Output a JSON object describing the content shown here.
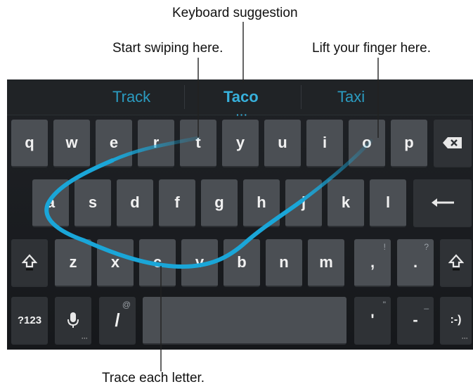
{
  "callouts": {
    "keyboard_suggestion": "Keyboard suggestion",
    "start_swiping": "Start swiping here.",
    "lift_finger": "Lift your finger here.",
    "trace_letter": "Trace each letter."
  },
  "suggestions": [
    "Track",
    "Taco",
    "Taxi"
  ],
  "suggestion_dots": "···",
  "rows": {
    "row1": [
      "q",
      "w",
      "e",
      "r",
      "t",
      "y",
      "u",
      "i",
      "o",
      "p"
    ],
    "row2": [
      "a",
      "s",
      "d",
      "f",
      "g",
      "h",
      "j",
      "k",
      "l"
    ],
    "row3": [
      "z",
      "x",
      "c",
      "v",
      "b",
      "n",
      "m"
    ],
    "row3_punct": [
      {
        "label": ",",
        "hint": "!"
      },
      {
        "label": ".",
        "hint": "?"
      }
    ]
  },
  "bottom": {
    "symbols": "?123",
    "slash": "/",
    "slash_hint": "@",
    "apostrophe": "'",
    "apostrophe_hint": "\"",
    "dash": "-",
    "dash_hint": "_",
    "smiley": ":-)"
  },
  "colors": {
    "swipe_trail": "#1aa6d8",
    "suggestion_text": "#2b9bc0",
    "key_background": "#4b4f54"
  },
  "icons": {
    "backspace": "backspace-icon",
    "enter": "enter-icon",
    "shift": "shift-icon",
    "mic": "microphone-icon"
  }
}
